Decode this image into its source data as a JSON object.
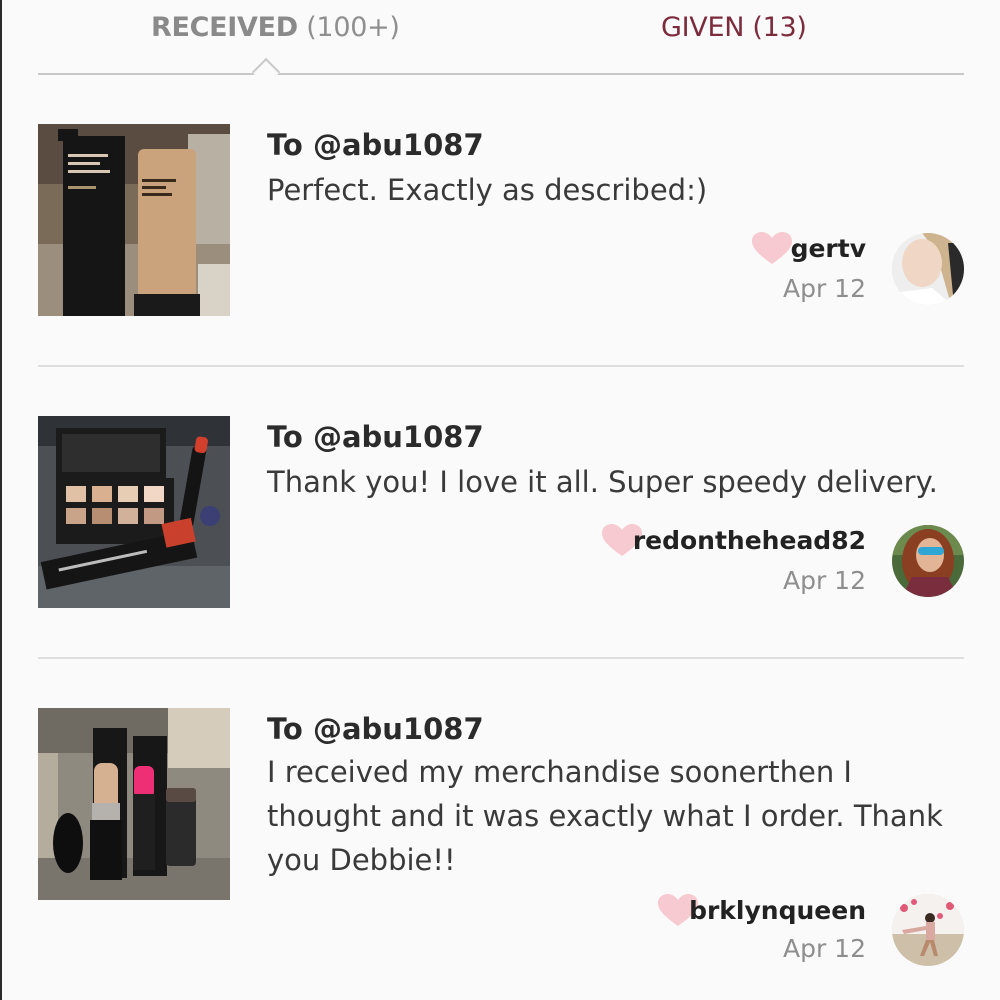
{
  "tabs": {
    "received_label": "RECEIVED",
    "received_count": "(100+)",
    "given_label": "GIVEN (13)",
    "active": "received"
  },
  "colors": {
    "given_tab": "#7b2b3c",
    "heart": "#f7c9d0"
  },
  "reviews": [
    {
      "to": "To @abu1087",
      "comment": "Perfect. Exactly as described:)",
      "username": "gertv",
      "date": "Apr 12",
      "thumb_icon": "tinted-moisturizer-photo",
      "avatar_icon": "avatar-blonde"
    },
    {
      "to": "To @abu1087",
      "comment": "Thank you! I love it all. Super speedy delivery.",
      "username": "redonthehead82",
      "date": "Apr 12",
      "thumb_icon": "palette-lip-pencil-photo",
      "avatar_icon": "avatar-redhead"
    },
    {
      "to": "To @abu1087",
      "comment": "I received my merchandise soonerthen I thought and it was exactly what I order. Thank you Debbie!!",
      "username": "brklynqueen",
      "date": "Apr 12",
      "thumb_icon": "lipsticks-photo",
      "avatar_icon": "avatar-beach"
    }
  ]
}
